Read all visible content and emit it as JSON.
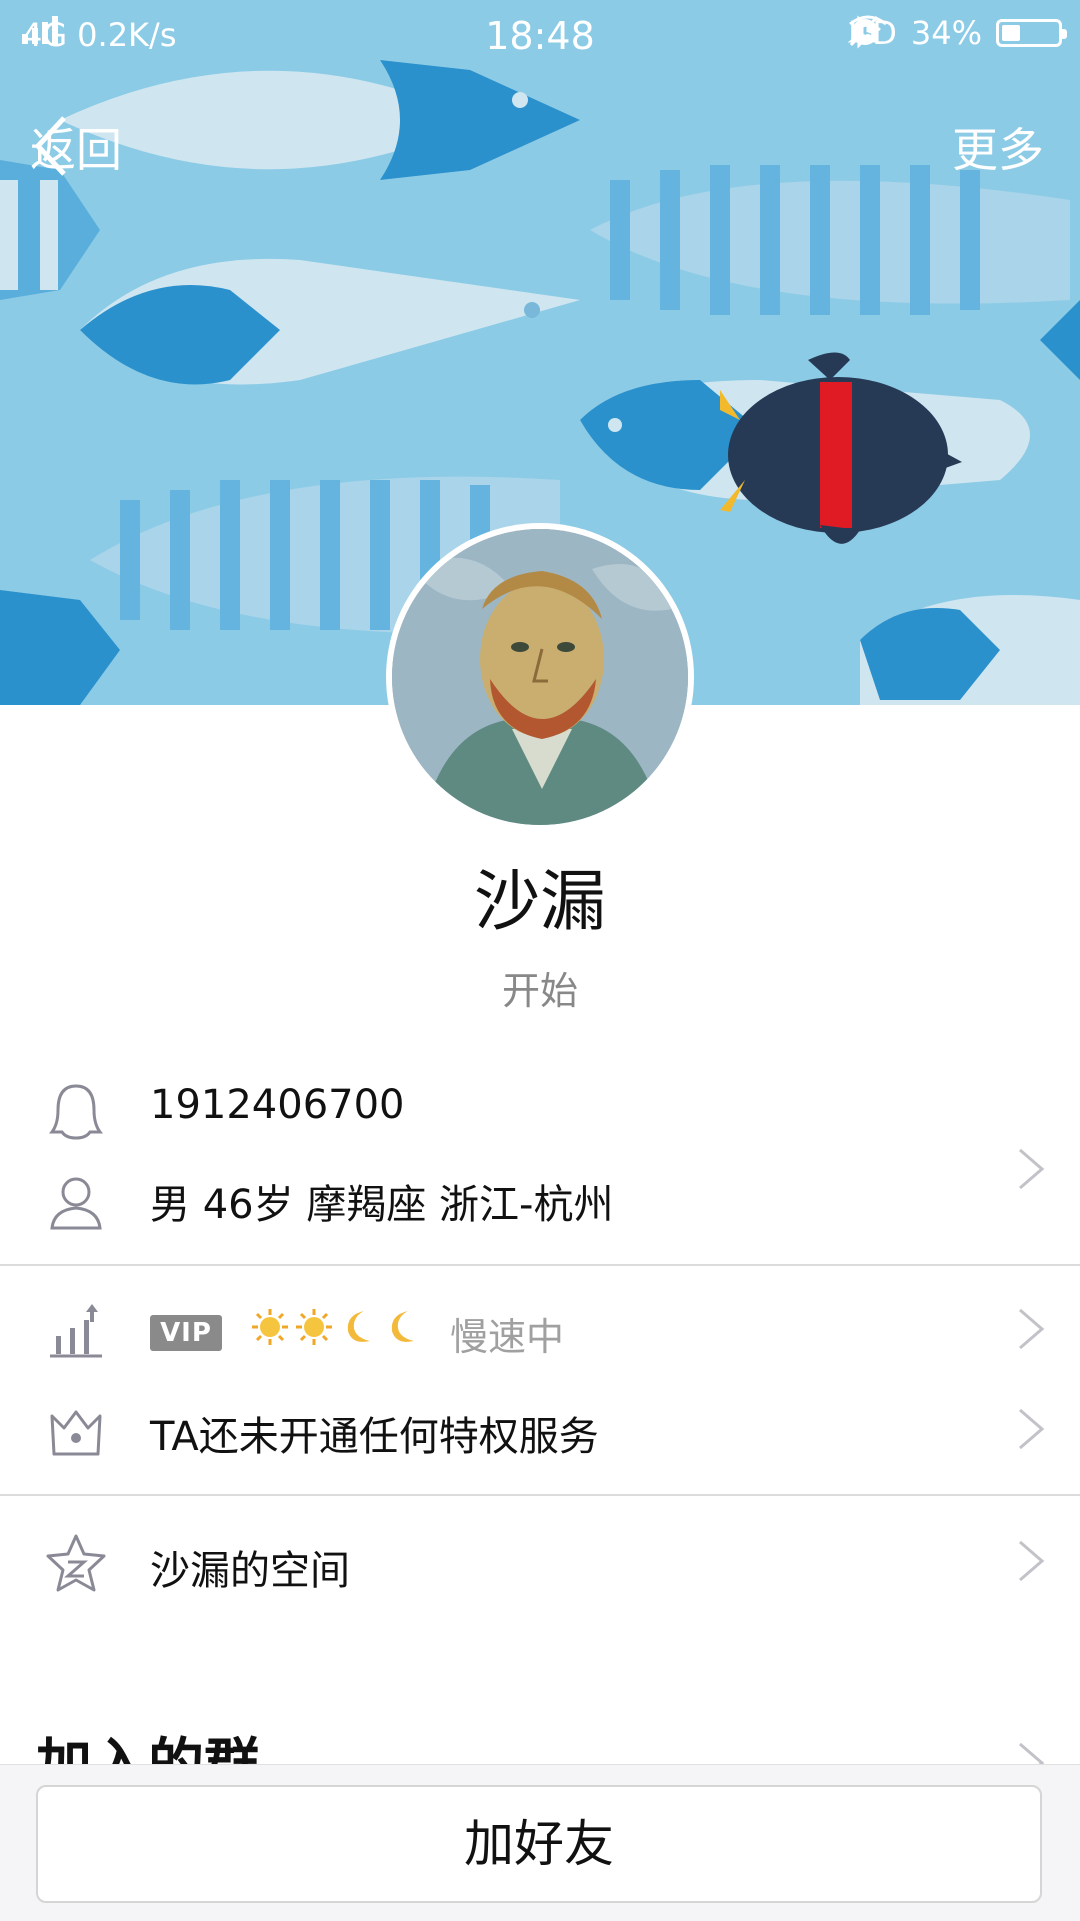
{
  "status_bar": {
    "network": "4G",
    "speed": "0.2K/s",
    "time": "18:48",
    "hd": "HD",
    "battery": "34%",
    "battery_level": 0.34
  },
  "nav": {
    "back_label": "返回",
    "more_label": "更多"
  },
  "profile": {
    "nickname": "沙漏",
    "signature": "开始",
    "qq_number": "1912406700",
    "info": "男  46岁  摩羯座  浙江-杭州"
  },
  "level": {
    "vip_label": "VIP",
    "level_icons": [
      "sun-icon",
      "sun-icon",
      "moon-icon",
      "moon-icon"
    ],
    "speed_text": "慢速中"
  },
  "privilege": {
    "text": "TA还未开通任何特权服务"
  },
  "space": {
    "text": "沙漏的空间"
  },
  "groups": {
    "title": "加入的群"
  },
  "actions": {
    "add_friend_label": "加好友"
  },
  "colors": {
    "cover_bg": "#8ccbe6",
    "accent_text": "#111111",
    "muted_text": "#888888"
  }
}
